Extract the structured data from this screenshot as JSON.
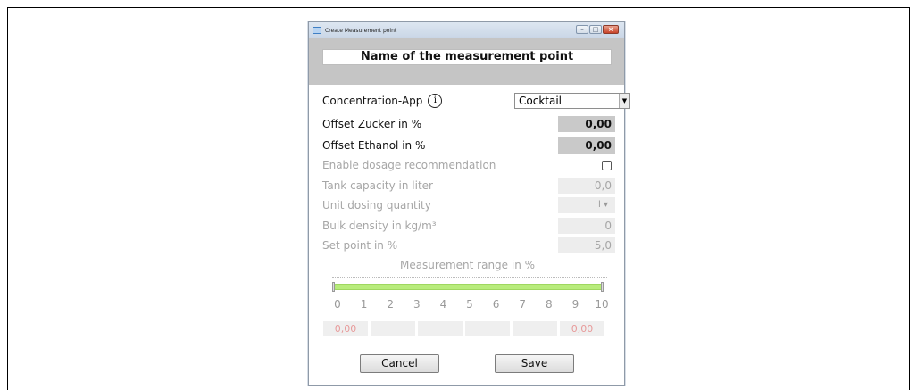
{
  "window": {
    "title": "Create Measurement point",
    "header_name": "Name of the measurement point"
  },
  "form": {
    "concentration_app": {
      "label": "Concentration-App",
      "info": "i",
      "value": "Cocktail"
    },
    "offset_zucker": {
      "label": "Offset Zucker in %",
      "value": "0,00"
    },
    "offset_ethanol": {
      "label": "Offset Ethanol in %",
      "value": "0,00"
    },
    "enable_dosage": {
      "label": "Enable dosage recommendation",
      "checked": false
    },
    "tank_capacity": {
      "label": "Tank capacity in liter",
      "value": "0,0"
    },
    "unit_dosing": {
      "label": "Unit dosing quantity",
      "value": "l"
    },
    "bulk_density": {
      "label": "Bulk density in kg/m³",
      "value": "0"
    },
    "set_point": {
      "label": "Set point in %",
      "value": "5,0"
    }
  },
  "range": {
    "title": "Measurement range in %",
    "ticks": [
      "0",
      "1",
      "2",
      "3",
      "4",
      "5",
      "6",
      "7",
      "8",
      "9",
      "10"
    ],
    "min": 0,
    "max": 10,
    "boxes": [
      {
        "value": "0,00",
        "color": "#e79a9a"
      },
      {
        "value": "",
        "color": "#ececec"
      },
      {
        "value": "",
        "color": "#ececec"
      },
      {
        "value": "",
        "color": "#ececec"
      },
      {
        "value": "",
        "color": "#ececec"
      },
      {
        "value": "0,00",
        "color": "#e79a9a"
      }
    ]
  },
  "buttons": {
    "cancel": "Cancel",
    "save": "Save"
  }
}
